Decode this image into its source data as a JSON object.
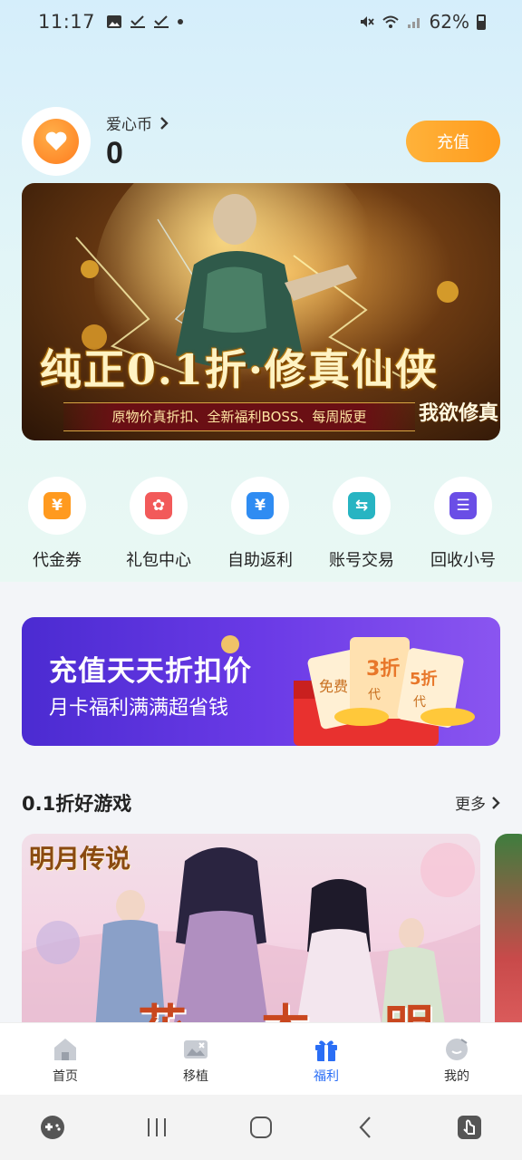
{
  "status_bar": {
    "time": "11:17",
    "battery": "62%"
  },
  "wallet": {
    "label": "爱心币",
    "value": "0",
    "recharge_label": "充值"
  },
  "hero_banner": {
    "tag": "我欲修真",
    "title": "纯正0.1折·修真仙侠",
    "subtitle": "原物价真折扣、全新福利BOSS、每周版更"
  },
  "quick_actions": [
    {
      "label": "代金券",
      "icon": "voucher-icon",
      "color": "#ff9a1f",
      "glyph": "¥"
    },
    {
      "label": "礼包中心",
      "icon": "gift-box-icon",
      "color": "#f25a5a",
      "glyph": "✿"
    },
    {
      "label": "自助返利",
      "icon": "rebate-icon",
      "color": "#2f8cf2",
      "glyph": "¥"
    },
    {
      "label": "账号交易",
      "icon": "exchange-icon",
      "color": "#27b4c2",
      "glyph": "⇆"
    },
    {
      "label": "回收小号",
      "icon": "recycle-icon",
      "color": "#6a4ee6",
      "glyph": "☰"
    }
  ],
  "promo": {
    "title": "充值天天折扣价",
    "subtitle": "月卡福利满满超省钱",
    "ticket_free": "免费",
    "ticket_3": "3折",
    "ticket_5": "5折",
    "ticket_dai": "代"
  },
  "section": {
    "title": "0.1折好游戏",
    "more": "更多"
  },
  "games": [
    {
      "logo": "明月传说",
      "overlay": "一花一木一明月"
    }
  ],
  "bottom_nav": [
    {
      "label": "首页",
      "icon": "home-icon",
      "active": false
    },
    {
      "label": "移植",
      "icon": "port-icon",
      "active": false
    },
    {
      "label": "福利",
      "icon": "gift-icon",
      "active": true
    },
    {
      "label": "我的",
      "icon": "profile-icon",
      "active": false
    }
  ],
  "colors": {
    "accent": "#2a6ef5",
    "recharge": "#ffa52a",
    "promo": "#5b34e0"
  }
}
